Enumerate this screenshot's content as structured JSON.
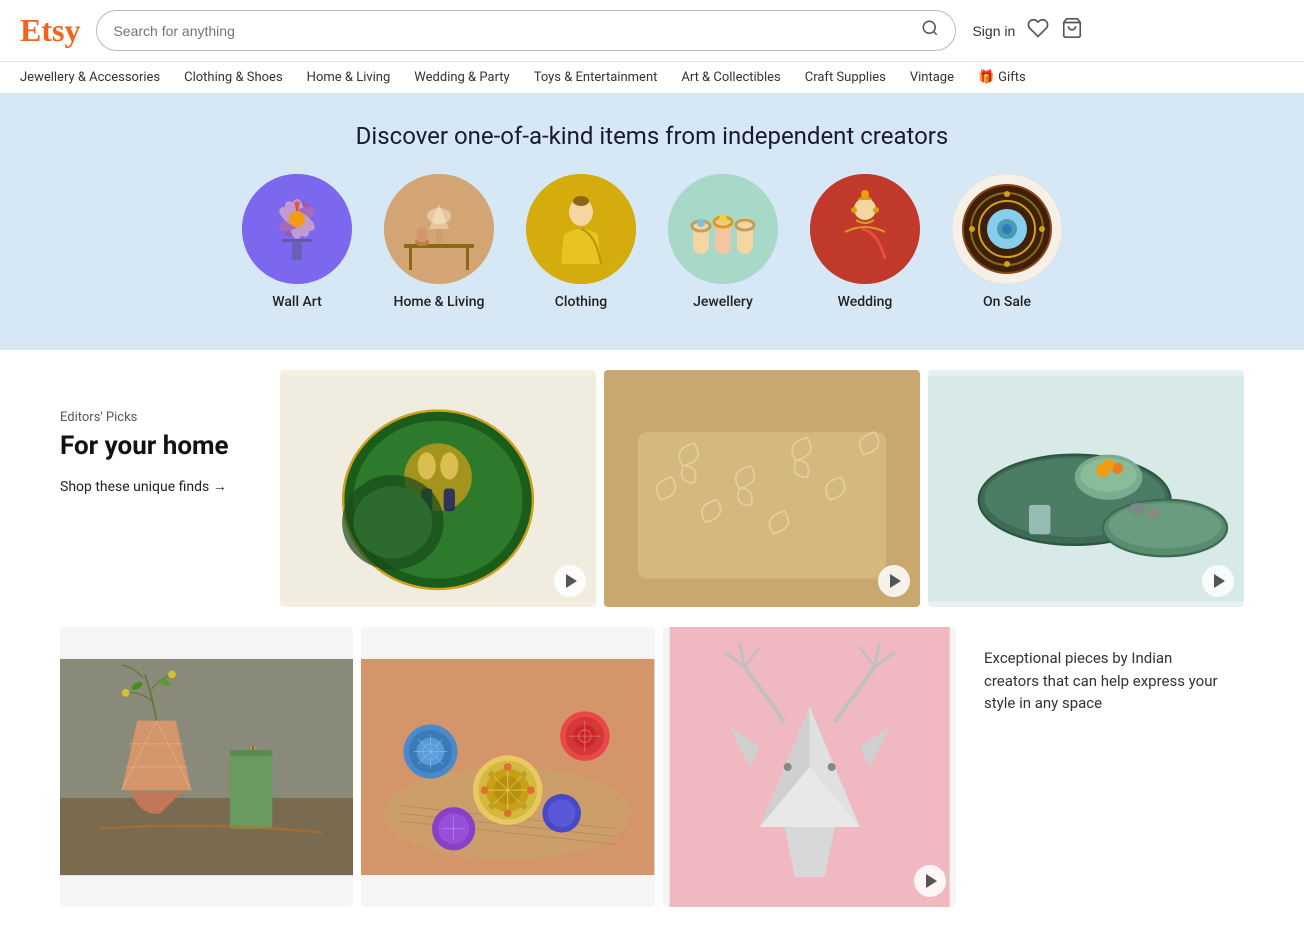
{
  "header": {
    "logo": "Etsy",
    "search_placeholder": "Search for anything",
    "sign_in": "Sign in"
  },
  "nav": {
    "items": [
      {
        "label": "Jewellery & Accessories"
      },
      {
        "label": "Clothing & Shoes"
      },
      {
        "label": "Home & Living"
      },
      {
        "label": "Wedding & Party"
      },
      {
        "label": "Toys & Entertainment"
      },
      {
        "label": "Art & Collectibles"
      },
      {
        "label": "Craft Supplies"
      },
      {
        "label": "Vintage"
      },
      {
        "label": "Gifts"
      }
    ]
  },
  "hero": {
    "headline": "Discover one-of-a-kind items from independent creators"
  },
  "categories": [
    {
      "id": "wall-art",
      "label": "Wall Art",
      "color_class": "c-wallart"
    },
    {
      "id": "home-living",
      "label": "Home & Living",
      "color_class": "c-homeliving"
    },
    {
      "id": "clothing",
      "label": "Clothing",
      "color_class": "c-clothing"
    },
    {
      "id": "jewellery",
      "label": "Jewellery",
      "color_class": "c-jewellery"
    },
    {
      "id": "wedding",
      "label": "Wedding",
      "color_class": "c-wedding"
    },
    {
      "id": "on-sale",
      "label": "On Sale",
      "color_class": "c-onsale"
    }
  ],
  "editors_picks": {
    "label": "Editors' Picks",
    "title": "For your home",
    "shop_link": "Shop these unique finds →"
  },
  "bottom_text": "Exceptional pieces by Indian creators that can help express your style in any space"
}
